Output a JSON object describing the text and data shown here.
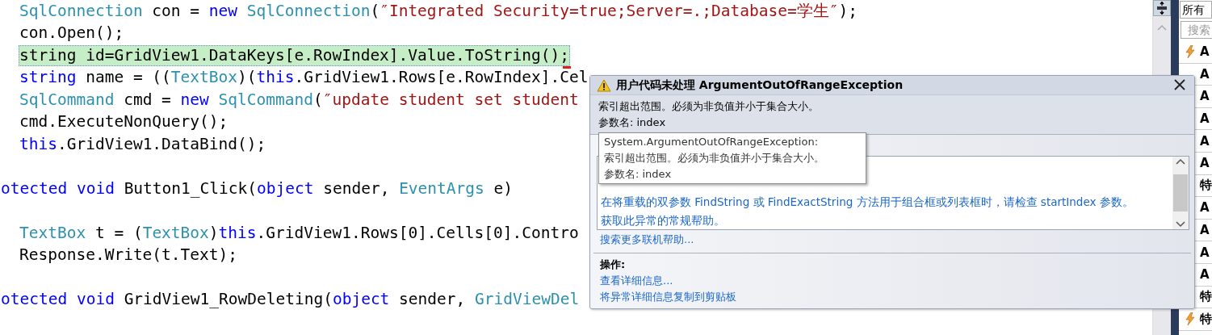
{
  "editor": {
    "lines": [
      {
        "kind": "code",
        "indent": true,
        "highlighted": false,
        "tokens": [
          {
            "kind": "type",
            "text": "SqlConnection"
          },
          {
            "kind": "plain",
            "text": " con = "
          },
          {
            "kind": "kw",
            "text": "new "
          },
          {
            "kind": "type",
            "text": "SqlConnection"
          },
          {
            "kind": "plain",
            "text": "("
          },
          {
            "kind": "str",
            "text": "″Integrated Security=true;Server=.;Database=学生″"
          },
          {
            "kind": "plain",
            "text": ");"
          }
        ]
      },
      {
        "kind": "code",
        "indent": true,
        "highlighted": false,
        "tokens": [
          {
            "kind": "plain",
            "text": "con.Open();"
          }
        ]
      },
      {
        "kind": "code",
        "indent": true,
        "highlighted": true,
        "tokens": [
          {
            "kind": "plain",
            "text": "string id=GridView1.DataKeys[e.RowIndex].Value.ToString();"
          }
        ]
      },
      {
        "kind": "code",
        "indent": true,
        "highlighted": false,
        "tokens": [
          {
            "kind": "kw",
            "text": "string"
          },
          {
            "kind": "plain",
            "text": " name = (("
          },
          {
            "kind": "type",
            "text": "TextBox"
          },
          {
            "kind": "plain",
            "text": ")("
          },
          {
            "kind": "kw",
            "text": "this"
          },
          {
            "kind": "plain",
            "text": ".GridView1.Rows[e.RowIndex].Cel"
          }
        ]
      },
      {
        "kind": "code",
        "indent": true,
        "highlighted": false,
        "tokens": [
          {
            "kind": "type",
            "text": "SqlCommand"
          },
          {
            "kind": "plain",
            "text": " cmd = "
          },
          {
            "kind": "kw",
            "text": "new "
          },
          {
            "kind": "type",
            "text": "SqlCommand"
          },
          {
            "kind": "plain",
            "text": "("
          },
          {
            "kind": "str",
            "text": "″update student set student"
          }
        ]
      },
      {
        "kind": "code",
        "indent": true,
        "highlighted": false,
        "tokens": [
          {
            "kind": "plain",
            "text": "cmd.ExecuteNonQuery();"
          }
        ]
      },
      {
        "kind": "code",
        "indent": true,
        "highlighted": false,
        "tokens": [
          {
            "kind": "kw",
            "text": "this"
          },
          {
            "kind": "plain",
            "text": ".GridView1.DataBind();"
          }
        ]
      },
      {
        "kind": "blank"
      },
      {
        "kind": "code",
        "indent": false,
        "highlighted": false,
        "tokens": [
          {
            "kind": "kw",
            "text": "otected void"
          },
          {
            "kind": "plain",
            "text": " Button1_Click("
          },
          {
            "kind": "kw",
            "text": "object"
          },
          {
            "kind": "plain",
            "text": " sender, "
          },
          {
            "kind": "type",
            "text": "EventArgs"
          },
          {
            "kind": "plain",
            "text": " e)"
          }
        ]
      },
      {
        "kind": "blank"
      },
      {
        "kind": "code",
        "indent": true,
        "highlighted": false,
        "tokens": [
          {
            "kind": "type",
            "text": "TextBox"
          },
          {
            "kind": "plain",
            "text": " t = ("
          },
          {
            "kind": "type",
            "text": "TextBox"
          },
          {
            "kind": "plain",
            "text": ")"
          },
          {
            "kind": "kw",
            "text": "this"
          },
          {
            "kind": "plain",
            "text": ".GridView1.Rows[0].Cells[0].Contro"
          }
        ]
      },
      {
        "kind": "code",
        "indent": true,
        "highlighted": false,
        "tokens": [
          {
            "kind": "plain",
            "text": "Response.Write(t.Text);"
          }
        ]
      },
      {
        "kind": "blank"
      },
      {
        "kind": "code",
        "indent": false,
        "highlighted": false,
        "tokens": [
          {
            "kind": "kw",
            "text": "otected void"
          },
          {
            "kind": "plain",
            "text": " GridView1_RowDeleting("
          },
          {
            "kind": "kw",
            "text": "object"
          },
          {
            "kind": "plain",
            "text": " sender, "
          },
          {
            "kind": "type",
            "text": "GridViewDel"
          }
        ]
      }
    ]
  },
  "exception_popup": {
    "title": "用户代码未处理 ArgumentOutOfRangeException",
    "message": "索引超出范围。必须为非负值并小于集合大小。",
    "param": "参数名: index",
    "tooltip": [
      "System.ArgumentOutOfRangeException:",
      "索引超出范围。必须为非负值并小于集合大小。",
      "参数名: index"
    ],
    "tips": [
      "在将重载的双参数 FindString 或 FindExactString 方法用于组合框或列表框时，请检查 startIndex 参数。",
      "获取此异常的常规帮助。"
    ],
    "search_link": "搜索更多联机帮助...",
    "actions_heading": "操作:",
    "actions": [
      "查看详细信息...",
      "将异常详细信息复制到剪贴板"
    ]
  },
  "side_panel": {
    "filter": "所有",
    "search": {
      "placeholder": "搜索"
    },
    "items": [
      {
        "kind": "event",
        "label": "A"
      },
      {
        "kind": "covered",
        "label": "A"
      },
      {
        "kind": "covered",
        "label": "A"
      },
      {
        "kind": "covered",
        "label": "A"
      },
      {
        "kind": "covered",
        "label": "A"
      },
      {
        "kind": "covered",
        "label": "A"
      },
      {
        "kind": "covered",
        "label": "特"
      },
      {
        "kind": "covered",
        "label": "A"
      },
      {
        "kind": "covered",
        "label": "A"
      },
      {
        "kind": "covered",
        "label": "A"
      },
      {
        "kind": "covered",
        "label": "A"
      },
      {
        "kind": "covered",
        "label": "特"
      },
      {
        "kind": "event",
        "label": "特"
      }
    ]
  }
}
